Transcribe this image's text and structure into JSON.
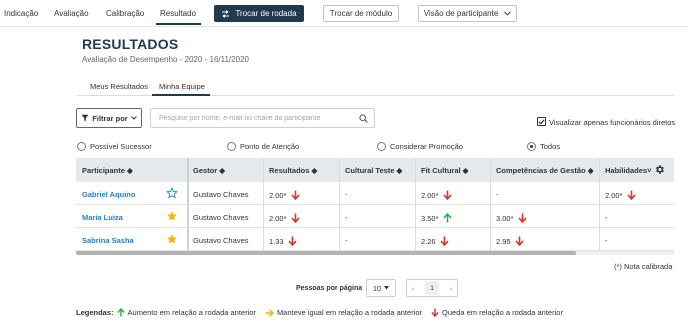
{
  "nav": {
    "items": [
      {
        "label": "Indicação"
      },
      {
        "label": "Avaliação"
      },
      {
        "label": "Calibração"
      },
      {
        "label": "Resultado"
      }
    ],
    "switch_round_label": "Trocar de rodada",
    "switch_module_label": "Trocar de módulo",
    "view_label": "Visão de participante"
  },
  "header": {
    "title": "RESULTADOS",
    "subtitle": "Avaliação de Desempenho - 2020 - 16/11/2020"
  },
  "tabs": [
    {
      "label": "Meus Resultados"
    },
    {
      "label": "Minha Equipe"
    }
  ],
  "filters": {
    "filter_label": "Filtrar por",
    "search_placeholder": "Pesquise por nome, e-mail ou chave do participante",
    "only_direct_label": "Visualizar apenas funcionários diretos",
    "radios": [
      {
        "label": "Possível Sucessor"
      },
      {
        "label": "Ponto de Atenção"
      },
      {
        "label": "Considerar Promoção"
      },
      {
        "label": "Todos"
      }
    ]
  },
  "table": {
    "columns": [
      "Participante",
      "Gestor",
      "Resultados",
      "Cultural Teste",
      "Fit Cultural",
      "Competências de Gestão",
      "Habilidades"
    ],
    "rows": [
      {
        "participant": "Gabriel Aquino",
        "manager": "Gustavo Chaves",
        "results": "2.00*",
        "cultural": "-",
        "fit": "2.00*",
        "comp": "-",
        "skills": "2.00*"
      },
      {
        "participant": "Maria Luiza",
        "manager": "Gustavo Chaves",
        "results": "2.00*",
        "cultural": "-",
        "fit": "3.50*",
        "comp": "3.00*",
        "skills": "-"
      },
      {
        "participant": "Sabrina Sasha",
        "manager": "Gustavo Chaves",
        "results": "1.33",
        "cultural": "-",
        "fit": "2.26",
        "comp": "2.95",
        "skills": "-"
      }
    ]
  },
  "note": "(*) Nota calibrada",
  "pagination": {
    "per_page_label": "Pessoas por página",
    "per_page_value": "10",
    "page": "1"
  },
  "legend": {
    "title": "Legendas:",
    "up": "Aumento em relação a rodada anterior",
    "same": "Manteve igual em relação a rodada anterior",
    "down": "Queda em relação a rodada anterior"
  },
  "colors": {
    "primary": "#1f3b4c",
    "link": "#1f7fc4",
    "up": "#2fae49",
    "down": "#d6332c",
    "same": "#f2b705",
    "star": "#f2b705"
  }
}
